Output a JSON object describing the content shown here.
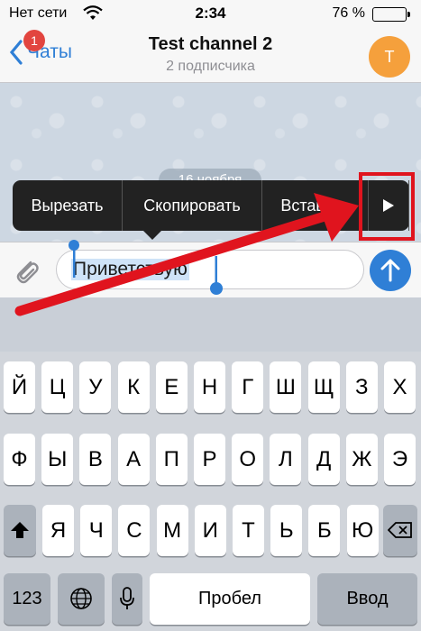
{
  "status": {
    "carrier": "Нет сети",
    "time": "2:34",
    "battery_pct": "76 %",
    "battery_level": 0.76
  },
  "nav": {
    "back_label": "Чаты",
    "badge": "1",
    "title": "Test channel 2",
    "subtitle": "2 подписчика",
    "avatar_letter": "T"
  },
  "chat": {
    "date": "16 ноября"
  },
  "edit_menu": {
    "cut": "Вырезать",
    "copy": "Скопировать",
    "paste": "Вставить"
  },
  "input": {
    "value": "Приветствую"
  },
  "keyboard": {
    "row1": [
      "Й",
      "Ц",
      "У",
      "К",
      "Е",
      "Н",
      "Г",
      "Ш",
      "Щ",
      "З",
      "Х"
    ],
    "row2": [
      "Ф",
      "Ы",
      "В",
      "А",
      "П",
      "Р",
      "О",
      "Л",
      "Д",
      "Ж",
      "Э"
    ],
    "row3": [
      "Я",
      "Ч",
      "С",
      "М",
      "И",
      "Т",
      "Ь",
      "Б",
      "Ю"
    ],
    "num_label": "123",
    "space_label": "Пробел",
    "return_label": "Ввод"
  },
  "colors": {
    "accent": "#2f7fd6",
    "badge": "#e2453f",
    "avatar": "#f5a03c",
    "annotation": "#e0141e"
  }
}
